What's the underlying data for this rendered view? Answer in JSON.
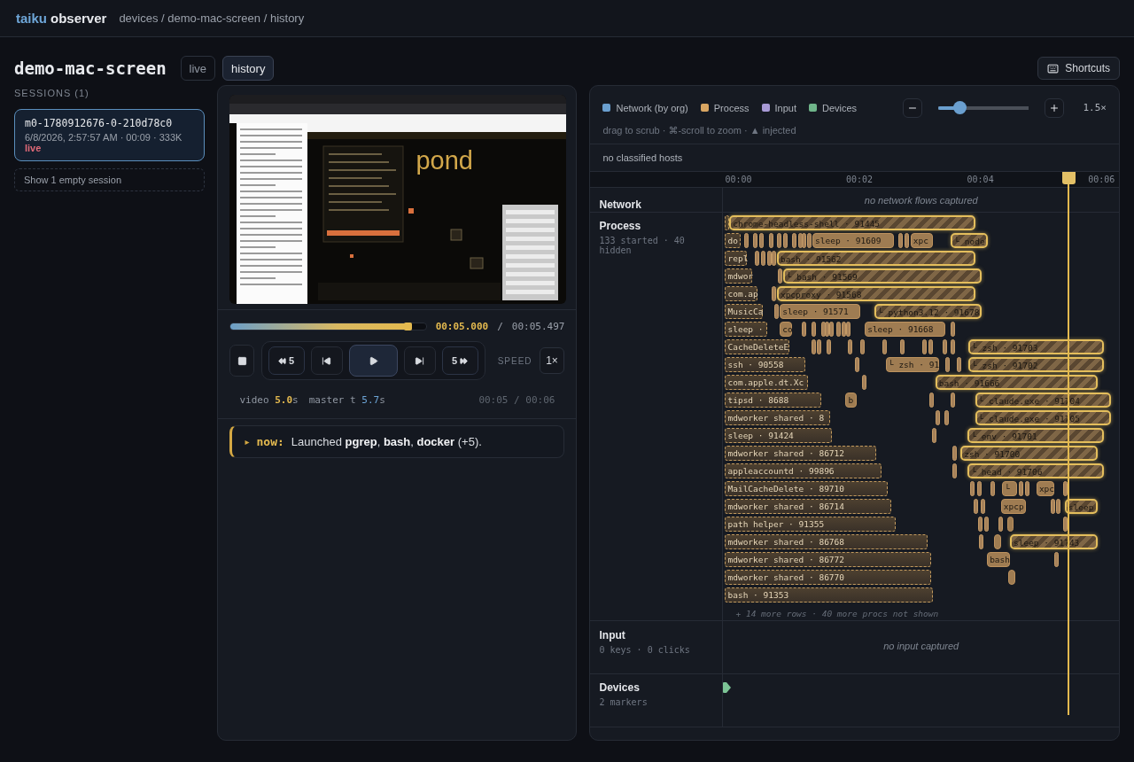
{
  "app": {
    "brand_a": "taiku",
    "brand_b": "observer",
    "breadcrumb": "devices / demo-mac-screen / history"
  },
  "page": {
    "title": "demo-mac-screen",
    "tabs": [
      {
        "label": "live",
        "selected": false
      },
      {
        "label": "history",
        "selected": true
      }
    ],
    "shortcuts": "Shortcuts"
  },
  "sessions": {
    "heading": "SESSIONS (1)",
    "items": [
      {
        "id": "m0-1780912676-0-210d78c0",
        "meta": "6/8/2026, 2:57:57 AM · 00:09 · 333K",
        "status": "live",
        "selected": true
      }
    ],
    "empty_toggle": "Show 1 empty session"
  },
  "player": {
    "frame_text": "pond",
    "scrub": {
      "level": 0.91
    },
    "current": "00:05.000",
    "separator": "/",
    "total": "00:05.497",
    "controls": [
      {
        "kind": "stop"
      },
      {
        "kind": "back",
        "label": "5"
      },
      {
        "kind": "prev"
      },
      {
        "kind": "play"
      },
      {
        "kind": "next"
      },
      {
        "kind": "forward",
        "label": "5"
      }
    ],
    "speed_label": "SPEED",
    "speed": "1×",
    "video": {
      "label": "video",
      "value": "5.0",
      "unit": "s"
    },
    "master": {
      "label": "master t",
      "value": "5.7",
      "unit": "s"
    },
    "clock": "00:05 / 00:06"
  },
  "event": {
    "marker": "▸",
    "tag": "now:",
    "text": "Launched **pgrep**, **bash**, **docker** (+5)."
  },
  "timeline": {
    "legend": [
      {
        "label": "Network (by org)",
        "color": "#6a9fcf"
      },
      {
        "label": "Process",
        "color": "#d9a662"
      },
      {
        "label": "Input",
        "color": "#a89ad6"
      },
      {
        "label": "Devices",
        "color": "#6fb58a"
      }
    ],
    "zoom": {
      "level": 0.24,
      "reading": "1.5×"
    },
    "hint": "drag to scrub · ⌘-scroll to zoom · ▲ injected",
    "hosts_note": "no classified hosts",
    "ticks": [
      {
        "label": "00:00"
      },
      {
        "label": "00:02"
      },
      {
        "label": "00:04"
      },
      {
        "label": "00:06"
      }
    ],
    "playhead": {
      "level": 0.873
    },
    "lanes": [
      {
        "kind": "network",
        "title": "Network",
        "empty_note": "no network flows captured"
      },
      {
        "kind": "process",
        "title": "Process",
        "summary": "133 started · 40 hidden",
        "more": "+ 14 more rows · 40 more procs not shown",
        "rows": [
          {
            "bars": [
              {
                "kind": "existing"
              },
              {
                "kind": "injected",
                "label": "chrome-headless-shell · 91445"
              }
            ]
          },
          {
            "bars": [
              {
                "kind": "existing",
                "label": "do"
              },
              {
                "kind": "blip"
              },
              {
                "kind": "blip"
              },
              {
                "kind": "blip"
              },
              {
                "kind": "blip"
              },
              {
                "kind": "blip"
              },
              {
                "kind": "blip"
              },
              {
                "kind": "blip"
              },
              {
                "kind": "blip"
              },
              {
                "kind": "blip"
              },
              {
                "kind": "blip"
              },
              {
                "kind": "short",
                "label": "sleep · 91609"
              },
              {
                "kind": "blip"
              },
              {
                "kind": "blip"
              },
              {
                "kind": "short",
                "label": "xpc"
              },
              {
                "kind": "injected",
                "label": "└ node"
              }
            ]
          },
          {
            "bars": [
              {
                "kind": "existing",
                "label": "repl"
              },
              {
                "kind": "blip"
              },
              {
                "kind": "blip"
              },
              {
                "kind": "blip"
              },
              {
                "kind": "blip"
              },
              {
                "kind": "injected",
                "label": "bash · 91562"
              }
            ]
          },
          {
            "bars": [
              {
                "kind": "existing",
                "label": "mdwor"
              },
              {
                "kind": "blip"
              },
              {
                "kind": "injected",
                "label": "└ bash · 91569"
              }
            ]
          },
          {
            "bars": [
              {
                "kind": "existing",
                "label": "com.ap"
              },
              {
                "kind": "blip"
              },
              {
                "kind": "injected",
                "label": "xpcproxy · 91568"
              }
            ]
          },
          {
            "bars": [
              {
                "kind": "existing",
                "label": "MusicCa"
              },
              {
                "kind": "blip"
              },
              {
                "kind": "short",
                "label": "sleep · 91571"
              },
              {
                "kind": "injected",
                "label": "└ python3.12 · 91678"
              }
            ]
          },
          {
            "bars": [
              {
                "kind": "existing",
                "label": "sleep ·"
              },
              {
                "kind": "short",
                "label": "co"
              },
              {
                "kind": "blip"
              },
              {
                "kind": "blip"
              },
              {
                "kind": "blip"
              },
              {
                "kind": "blip"
              },
              {
                "kind": "blip"
              },
              {
                "kind": "blip"
              },
              {
                "kind": "blip"
              },
              {
                "kind": "blip"
              },
              {
                "kind": "short",
                "label": "sleep · 91668"
              },
              {
                "kind": "blip"
              }
            ]
          },
          {
            "bars": [
              {
                "kind": "existing",
                "label": "CacheDeleteE"
              },
              {
                "kind": "blip"
              },
              {
                "kind": "blip"
              },
              {
                "kind": "blip"
              },
              {
                "kind": "blip"
              },
              {
                "kind": "blip"
              },
              {
                "kind": "blip"
              },
              {
                "kind": "blip"
              },
              {
                "kind": "blip"
              },
              {
                "kind": "blip"
              },
              {
                "kind": "blip"
              },
              {
                "kind": "blip"
              },
              {
                "kind": "injected",
                "label": "└ zsh · 91703"
              }
            ]
          },
          {
            "bars": [
              {
                "kind": "existing",
                "label": "ssh · 90558"
              },
              {
                "kind": "blip"
              },
              {
                "kind": "short",
                "label": "└ zsh · 91"
              },
              {
                "kind": "blip"
              },
              {
                "kind": "blip"
              },
              {
                "kind": "injected",
                "label": "└ zsh · 91702"
              }
            ]
          },
          {
            "bars": [
              {
                "kind": "existing",
                "label": "com.apple.dt.Xc"
              },
              {
                "kind": "blip"
              },
              {
                "kind": "injected",
                "label": "bash · 91666"
              }
            ]
          },
          {
            "bars": [
              {
                "kind": "existing",
                "label": "tipsd · 8688"
              },
              {
                "kind": "short",
                "label": "b"
              },
              {
                "kind": "blip"
              },
              {
                "kind": "blip"
              },
              {
                "kind": "injected",
                "label": "└ claude.exe · 91704"
              }
            ]
          },
          {
            "bars": [
              {
                "kind": "existing",
                "label": "mdworker shared · 8"
              },
              {
                "kind": "blip"
              },
              {
                "kind": "blip"
              },
              {
                "kind": "injected",
                "label": "└ claude.exe · 91705"
              }
            ]
          },
          {
            "bars": [
              {
                "kind": "existing",
                "label": "sleep · 91424"
              },
              {
                "kind": "blip"
              },
              {
                "kind": "injected",
                "label": "└ env · 91701"
              }
            ]
          },
          {
            "bars": [
              {
                "kind": "existing",
                "label": "mdworker shared · 86712"
              },
              {
                "kind": "blip"
              },
              {
                "kind": "injected",
                "label": "zsh · 91700"
              }
            ]
          },
          {
            "bars": [
              {
                "kind": "existing",
                "label": "appleaccountd · 99896"
              },
              {
                "kind": "blip"
              },
              {
                "kind": "injected",
                "label": "└ head · 91706"
              }
            ]
          },
          {
            "bars": [
              {
                "kind": "existing",
                "label": "MailCacheDelete · 89710"
              },
              {
                "kind": "blip"
              },
              {
                "kind": "blip"
              },
              {
                "kind": "blip"
              },
              {
                "kind": "short",
                "label": "└"
              },
              {
                "kind": "blip"
              },
              {
                "kind": "blip"
              },
              {
                "kind": "short",
                "label": "xpc"
              },
              {
                "kind": "blip"
              }
            ]
          },
          {
            "bars": [
              {
                "kind": "existing",
                "label": "mdworker shared · 86714"
              },
              {
                "kind": "blip"
              },
              {
                "kind": "blip"
              },
              {
                "kind": "short",
                "label": "xpcp"
              },
              {
                "kind": "blip"
              },
              {
                "kind": "blip"
              },
              {
                "kind": "injected",
                "label": "sleep"
              }
            ]
          },
          {
            "bars": [
              {
                "kind": "existing",
                "label": "path helper · 91355"
              },
              {
                "kind": "blip"
              },
              {
                "kind": "blip"
              },
              {
                "kind": "blip"
              },
              {
                "kind": "short"
              },
              {
                "kind": "blip"
              }
            ]
          },
          {
            "bars": [
              {
                "kind": "existing",
                "label": "mdworker shared · 86768"
              },
              {
                "kind": "blip"
              },
              {
                "kind": "short"
              },
              {
                "kind": "injected",
                "label": "sleep · 91743"
              }
            ]
          },
          {
            "bars": [
              {
                "kind": "existing",
                "label": "mdworker shared · 86772"
              },
              {
                "kind": "short",
                "label": "bash"
              },
              {
                "kind": "blip"
              }
            ]
          },
          {
            "bars": [
              {
                "kind": "existing",
                "label": "mdworker shared · 86770"
              },
              {
                "kind": "short"
              }
            ]
          },
          {
            "bars": [
              {
                "kind": "existing",
                "label": "bash · 91353"
              }
            ]
          }
        ]
      },
      {
        "kind": "input",
        "title": "Input",
        "summary": "0 keys · 0 clicks",
        "empty_note": "no input captured"
      },
      {
        "kind": "devices",
        "title": "Devices",
        "summary": "2 markers",
        "markers": [
          {
            "kind": "flag"
          }
        ]
      }
    ]
  }
}
